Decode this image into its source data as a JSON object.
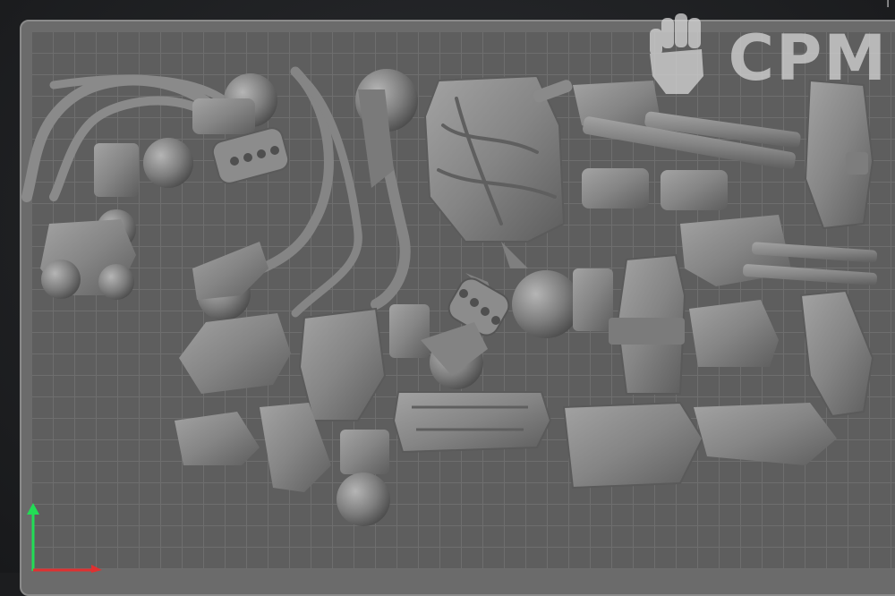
{
  "watermark": {
    "text": "CPM",
    "icon": "raised-fist-icon"
  },
  "corner_glyph": "i",
  "colors": {
    "background": "#1c1d1f",
    "bed": "#5e5e5e",
    "bed_border": "#8a8a8a",
    "grid": "#6e6e6e",
    "model": "#8e8e8e",
    "y_axis": "#22dd55",
    "x_axis": "#e03030"
  },
  "axes": [
    "y-axis",
    "x-axis"
  ]
}
